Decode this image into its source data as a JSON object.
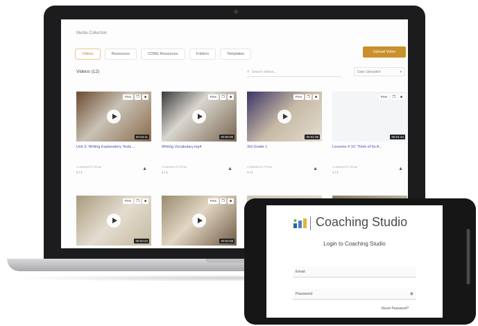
{
  "laptop": {
    "breadcrumb": "Media Collection",
    "tabs": [
      {
        "label": "Videos"
      },
      {
        "label": "Resources"
      },
      {
        "label": "CORE Resources"
      },
      {
        "label": "Folders"
      },
      {
        "label": "Templates"
      }
    ],
    "add_button": "Upload Video",
    "count_label": "Videos (12)",
    "search_placeholder": "Search videos...",
    "sort_label": "Date Uploaded",
    "videos": [
      {
        "title": "Unit 3: Writing Explanatory Texts ...",
        "tag": "Pres",
        "duration": "00:04:11",
        "meta_label": "COMMENTS FROM",
        "meta_value": "2 / 1"
      },
      {
        "title": "Writing Vocabulary.mp4",
        "tag": "Pres",
        "duration": "00:05:06",
        "meta_label": "COMMENTS FROM",
        "meta_value": "1 / 1"
      },
      {
        "title": "3rd Grade 1",
        "tag": "Pres",
        "duration": "00:02:38",
        "meta_label": "COMMENTS FROM",
        "meta_value": "1 / 1"
      },
      {
        "title": "Lessons 4 10: Think of Its A...",
        "tag": "Pres",
        "duration": "00:01:34",
        "meta_label": "COMMENTS FROM",
        "meta_value": "1 / 1"
      },
      {
        "title": "",
        "tag": "Pres",
        "duration": "00:03:22",
        "meta_label": "",
        "meta_value": ""
      },
      {
        "title": "",
        "tag": "Pres",
        "duration": "00:02:58",
        "meta_label": "",
        "meta_value": ""
      },
      {
        "title": "",
        "tag": "",
        "duration": "",
        "meta_label": "",
        "meta_value": ""
      },
      {
        "title": "",
        "tag": "",
        "duration": "",
        "meta_label": "",
        "meta_value": ""
      }
    ],
    "colors": {
      "accent": "#c9902c",
      "link": "#4a52a8"
    }
  },
  "phone": {
    "brand": "Coaching Studio",
    "login_title": "Login to Coaching Studio",
    "email_placeholder": "Email",
    "password_placeholder": "Password",
    "reset_link": "Reset Password?"
  }
}
